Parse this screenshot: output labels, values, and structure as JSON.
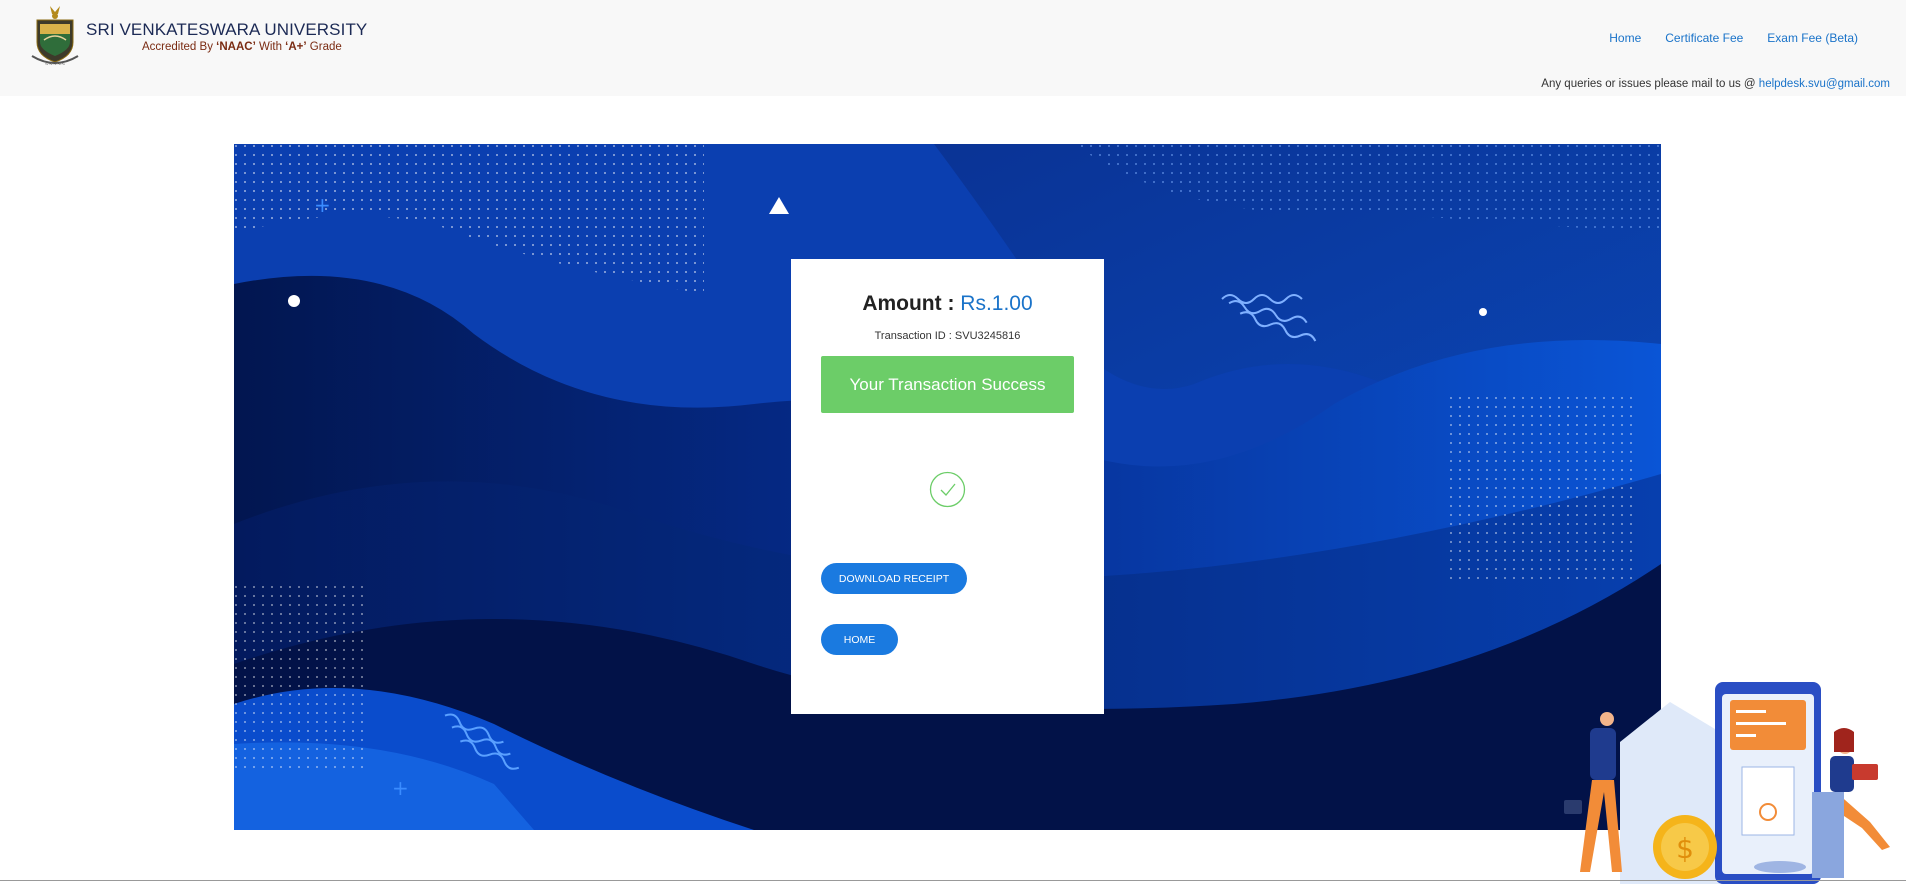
{
  "header": {
    "title": "SRI VENKATESWARA UNIVERSITY",
    "subtitle_prefix": "Accredited By ",
    "subtitle_naac": "‘NAAC’",
    "subtitle_mid": " With ",
    "subtitle_grade": "‘A+’",
    "subtitle_suffix": " Grade",
    "nav": {
      "home": "Home",
      "certificate_fee": "Certificate Fee",
      "exam_fee": "Exam Fee (Beta)"
    },
    "query_text": "Any queries or issues please mail to us @ ",
    "query_email": "helpdesk.svu@gmail.com"
  },
  "card": {
    "amount_label": "Amount : ",
    "amount_value": "Rs.1.00",
    "transaction_text": "Transaction ID : SVU3245816",
    "success_text": "Your Transaction Success",
    "download_label": "DOWNLOAD RECEIPT",
    "home_label": "HOME",
    "status_icon": "check-circle-icon"
  },
  "colors": {
    "accent": "#1a73c9",
    "success": "#6ccd68",
    "button": "#1a7ae0",
    "banner_dark": "#031b58",
    "banner_light": "#0a55d6"
  }
}
